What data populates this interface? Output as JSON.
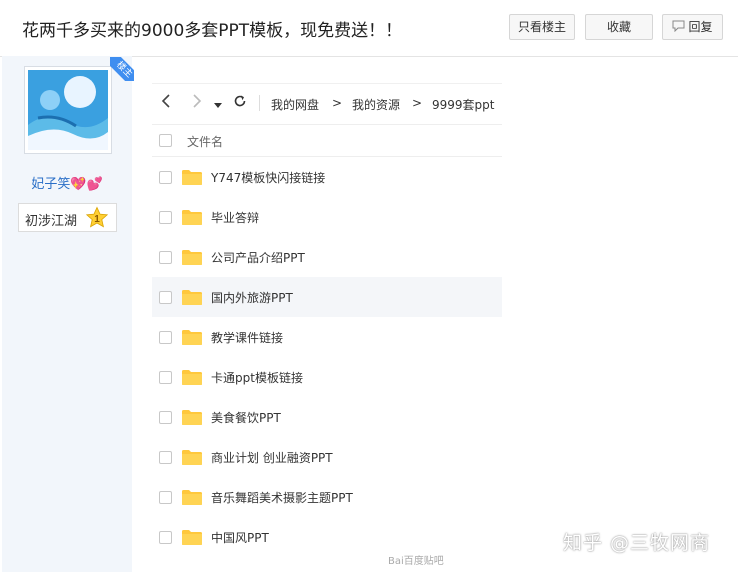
{
  "post": {
    "title": "花两千多买来的9000多套PPT模板，现免费送！！",
    "buttons": {
      "only_op": "只看楼主",
      "favorite": "收藏",
      "reply": "回复"
    }
  },
  "author": {
    "ribbon": "楼主",
    "name": "妃子笑💖💕",
    "level_title": "初涉江湖",
    "level_number": "1"
  },
  "filemanager": {
    "breadcrumb": [
      "我的网盘",
      "我的资源",
      "9999套ppt"
    ],
    "breadcrumb_sep": ">",
    "column_header": "文件名",
    "files": [
      "Y747模板快闪接链接",
      "毕业答辩",
      "公司产品介绍PPT",
      "国内外旅游PPT",
      "教学课件链接",
      "卡通ppt模板链接",
      "美食餐饮PPT",
      "商业计划  创业融资PPT",
      "音乐舞蹈美术摄影主题PPT",
      "中国风PPT"
    ],
    "hovered_row": 3
  },
  "watermarks": {
    "zhihu": "知乎 @三牧网商",
    "baidu": "Bai百度贴吧"
  },
  "colors": {
    "folder": "#ffc83d",
    "link": "#2a6fc7",
    "ribbon": "#3f8ef0"
  }
}
